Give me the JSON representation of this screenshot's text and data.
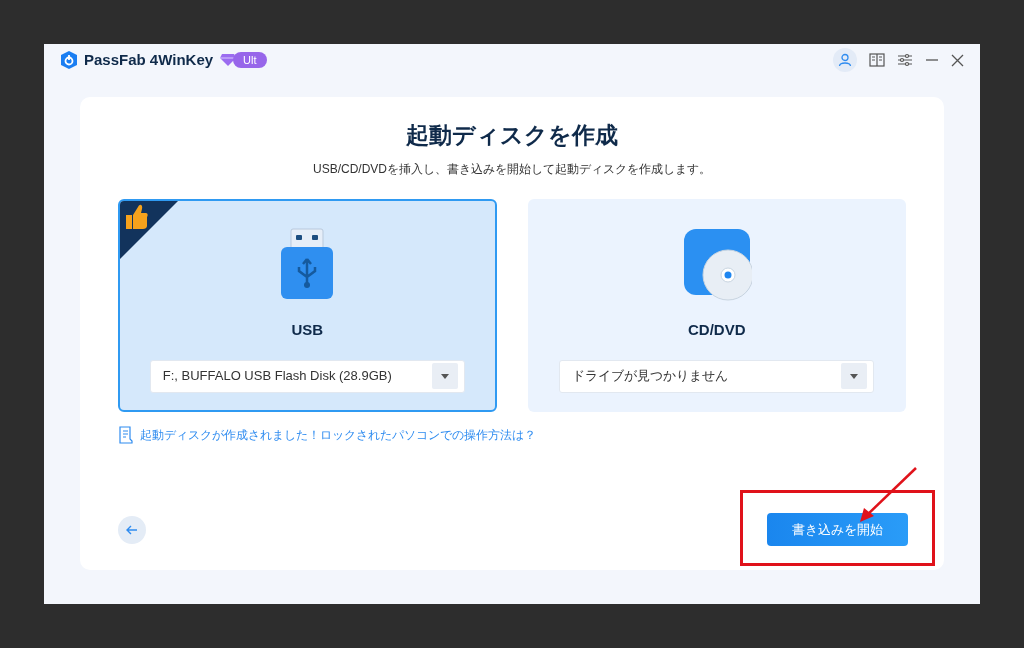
{
  "app": {
    "name": "PassFab 4WinKey",
    "badge": "Ult"
  },
  "page": {
    "title": "起動ディスクを作成",
    "subtitle": "USB/CD/DVDを挿入し、書き込みを開始して起動ディスクを作成します。"
  },
  "options": [
    {
      "kind": "usb",
      "label": "USB",
      "selected": true,
      "recommended": true,
      "drive": "F:, BUFFALO USB Flash Disk (28.9GB)"
    },
    {
      "kind": "disc",
      "label": "CD/DVD",
      "selected": false,
      "recommended": false,
      "drive": "ドライブが見つかりません"
    }
  ],
  "help_link": "起動ディスクが作成されました！ロックされたパソコンでの操作方法は？",
  "start_button": "書き込みを開始"
}
